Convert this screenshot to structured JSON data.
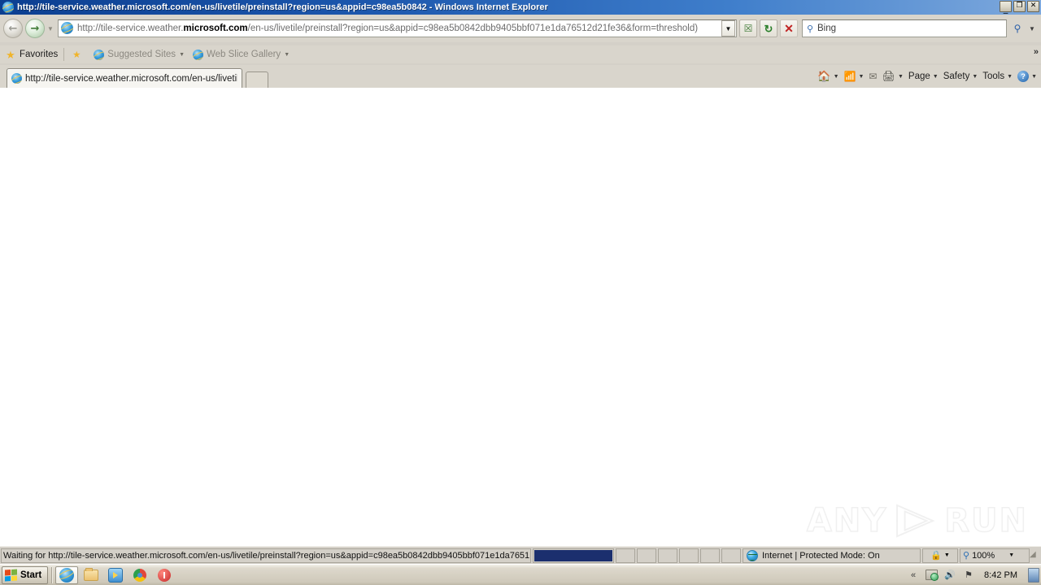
{
  "window": {
    "title": "http://tile-service.weather.microsoft.com/en-us/livetile/preinstall?region=us&appid=c98ea5b0842 - Windows Internet Explorer",
    "minimize_label": "_",
    "maximize_label": "❐",
    "close_label": "✕",
    "titlebar_color": "#1c57ad"
  },
  "navigation": {
    "back_label": "←",
    "forward_label": "→",
    "recent_pages_caret": "▼",
    "address": {
      "prefix": "http://tile-service.weather.",
      "domain": "microsoft.com",
      "suffix": "/en-us/livetile/preinstall?region=us&appid=c98ea5b0842dbb9405bbf071e1da76512d21fe36&form=threshold)",
      "full": "http://tile-service.weather.microsoft.com/en-us/livetile/preinstall?region=us&appid=c98ea5b0842dbb9405bbf071e1da76512d21fe36&form=threshold)",
      "dropdown_caret": "▼"
    },
    "compatibility_label": "☒",
    "refresh_label": "↻",
    "stop_label": "✕",
    "search": {
      "value": "Bing",
      "placeholder": "Bing",
      "go_label": "⌕",
      "dropdown_caret": "▼"
    }
  },
  "favorites_bar": {
    "favorites_label": "Favorites",
    "items": [
      {
        "label": "Suggested Sites",
        "caret": "▼"
      },
      {
        "label": "Web Slice Gallery",
        "caret": "▼"
      }
    ]
  },
  "tabs": {
    "active": {
      "title": "http://tile-service.weather.microsoft.com/en-us/livetil..."
    },
    "new_tab_label": ""
  },
  "command_bar": {
    "items": [
      {
        "name": "home",
        "label": "",
        "caret": "▼"
      },
      {
        "name": "feeds",
        "label": "",
        "caret": "▼"
      },
      {
        "name": "read-mail",
        "label": "",
        "caret": ""
      },
      {
        "name": "print",
        "label": "",
        "caret": "▼"
      },
      {
        "name": "page",
        "label": "Page",
        "caret": "▼"
      },
      {
        "name": "safety",
        "label": "Safety",
        "caret": "▼"
      },
      {
        "name": "tools",
        "label": "Tools",
        "caret": "▼"
      },
      {
        "name": "help",
        "label": "",
        "caret": "▼"
      }
    ],
    "overflow_label": "»"
  },
  "page": {
    "content": "",
    "watermark": {
      "left": "ANY",
      "right": "RUN"
    }
  },
  "status_bar": {
    "message": "Waiting for http://tile-service.weather.microsoft.com/en-us/livetile/preinstall?region=us&appid=c98ea5b0842dbb9405bbf071e1da7651",
    "progress_percent": 100,
    "progress_color": "#1b2f6e",
    "empty_segments": 6,
    "zone": "Internet | Protected Mode: On",
    "protected_mode_caret": "▼",
    "zoom": "100%",
    "zoom_caret": "▼"
  },
  "taskbar": {
    "start_label": "Start",
    "items": [
      {
        "name": "internet-explorer",
        "active": true
      },
      {
        "name": "windows-explorer",
        "active": false
      },
      {
        "name": "media-player",
        "active": false
      },
      {
        "name": "chrome-browser",
        "active": false
      },
      {
        "name": "power-app",
        "active": false
      }
    ],
    "tray": {
      "show_hidden_label": "«",
      "network_label": "",
      "volume_label": "🔊",
      "action_center_label": "⚑",
      "clock": "8:42 PM"
    }
  }
}
